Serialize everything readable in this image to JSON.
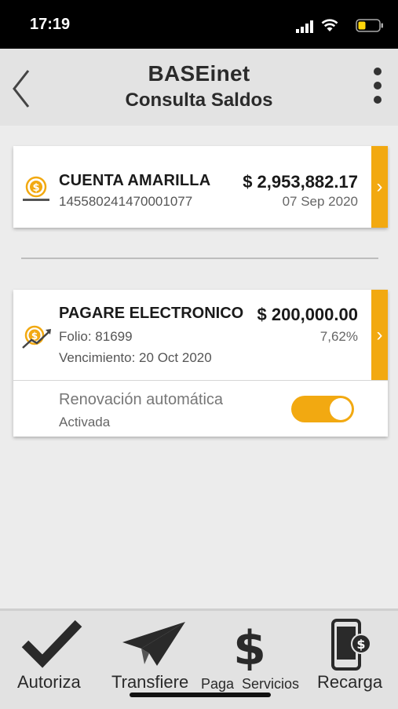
{
  "status_bar": {
    "time": "17:19"
  },
  "nav": {
    "title": "BASEinet",
    "subtitle": "Consulta Saldos"
  },
  "account": {
    "name": "CUENTA AMARILLA",
    "number": "145580241470001077",
    "balance": "$ 2,953,882.17",
    "date": "07 Sep 2020",
    "arrow": "›"
  },
  "pagare": {
    "name": "PAGARE ELECTRONICO",
    "folio": "Folio: 81699",
    "vencimiento": "Vencimiento: 20 Oct 2020",
    "amount": "$ 200,000.00",
    "rate": "7,62%",
    "arrow": "›",
    "renovacion_label": "Renovación automática",
    "renovacion_status": "Activada",
    "renovacion_on": true
  },
  "tabs": [
    {
      "label": "Autoriza",
      "icon": "checkmark-icon"
    },
    {
      "label": "Transfiere",
      "icon": "paper-plane-icon"
    },
    {
      "label": "Paga  Servicios",
      "icon": "dollar-icon"
    },
    {
      "label": "Recarga",
      "icon": "phone-dollar-icon"
    }
  ],
  "colors": {
    "accent": "#f2a911",
    "status_bar": "#000000",
    "nav_bg": "#e3e3e3",
    "page_bg": "#ececec"
  }
}
